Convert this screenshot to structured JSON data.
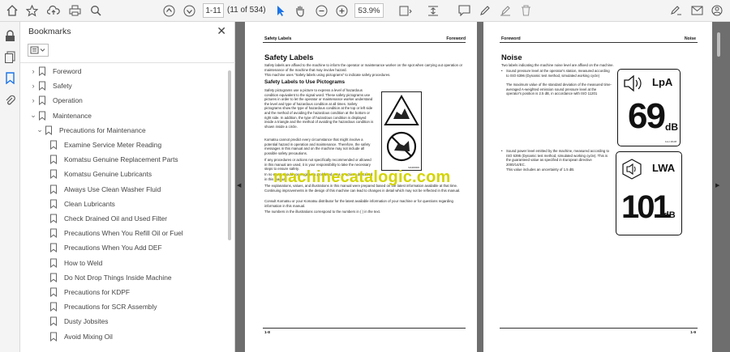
{
  "toolbar": {
    "page_current": "1-11",
    "page_count": "(11 of 534)",
    "zoom": "53.9%"
  },
  "bookmarks": {
    "title": "Bookmarks",
    "close_glyph": "✕",
    "items": [
      {
        "label": "Foreword",
        "level": 0,
        "caret": "›"
      },
      {
        "label": "Safety",
        "level": 0,
        "caret": "›"
      },
      {
        "label": "Operation",
        "level": 0,
        "caret": "›"
      },
      {
        "label": "Maintenance",
        "level": 0,
        "caret": "⌄"
      },
      {
        "label": "Precautions for Maintenance",
        "level": 1,
        "caret": "⌄"
      },
      {
        "label": "Examine Service Meter Reading",
        "level": 2,
        "caret": ""
      },
      {
        "label": "Komatsu Genuine Replacement Parts",
        "level": 2,
        "caret": ""
      },
      {
        "label": "Komatsu Genuine Lubricants",
        "level": 2,
        "caret": ""
      },
      {
        "label": "Always Use Clean Washer Fluid",
        "level": 2,
        "caret": ""
      },
      {
        "label": "Clean Lubricants",
        "level": 2,
        "caret": ""
      },
      {
        "label": "Check Drained Oil and Used Filter",
        "level": 2,
        "caret": ""
      },
      {
        "label": "Precautions When You Refill Oil or Fuel",
        "level": 2,
        "caret": ""
      },
      {
        "label": "Precautions When You Add DEF",
        "level": 2,
        "caret": ""
      },
      {
        "label": "How to Weld",
        "level": 2,
        "caret": ""
      },
      {
        "label": "Do Not Drop Things Inside Machine",
        "level": 2,
        "caret": ""
      },
      {
        "label": "Precautions for KDPF",
        "level": 2,
        "caret": ""
      },
      {
        "label": "Precautions for SCR Assembly",
        "level": 2,
        "caret": ""
      },
      {
        "label": "Dusty Jobsites",
        "level": 2,
        "caret": ""
      },
      {
        "label": "Avoid Mixing Oil",
        "level": 2,
        "caret": ""
      }
    ]
  },
  "left_page": {
    "header_left": "Safety Labels",
    "header_right": "Foreword",
    "title": "Safety Labels",
    "intro1": "Safety labels are affixed to the machine to inform the operator or maintenance worker on the spot when carrying out operation or maintenance of the machine that may involve hazard.",
    "intro2": "This machine uses “Safety labels using pictograms” to indicate safety procedures.",
    "subtitle": "Safety Labels to Use Pictograms",
    "para1": "Safety pictograms use a picture to express a level of hazardous condition equivalent to the signal word. These safety pictograms use pictures in order to let the operator or maintenance worker understand the level and type of hazardous condition at all times. Safety pictograms show the type of hazardous condition at the top or left side and the method of avoiding the hazardous condition at the bottom or right side. In addition, the type of hazardous condition is displayed inside a triangle and the method of avoiding the hazardous condition is shown inside a circle.",
    "para2": "Komatsu cannot predict every circumstance that might involve a potential hazard in operation and maintenance. Therefore, the safety messages in this manual and on the machine may not include all possible safety precautions.",
    "para3": "If any procedures or actions not specifically recommended or allowed in this manual are used, it is your responsibility to take the necessary steps to ensure safety.",
    "para4": "In no event should you engage in prohibited uses or actions described in this manual.",
    "para5": "The explanations, values, and illustrations in this manual were prepared based on the latest information available at that time. Continuing improvements in the design of this machine can lead to changes in detail which may not be reflected in this manual.",
    "para6": "Consult Komatsu or your Komatsu distributor for the latest available information of your machine or for questions regarding information in this manual.",
    "para7": "The numbers in the illustrations correspond to the numbers in ( ) in the text.",
    "figure_code": "9JH00000",
    "footer": "1-8"
  },
  "right_page": {
    "header_left": "Foreword",
    "header_right": "Noise",
    "title": "Noise",
    "intro": "Two labels indicating the machine noise level are affixed on the machine.",
    "bullet1": "Sound pressure level at the operator's station, measured according to ISO 6396 (Dynamic test method, simulated working cycle)",
    "bullet1b": "The maximum value of the standard deviation of the measured time-averaged A-weighted emission sound pressure level at the operator's position is 2.5 dB, in accordance with ISO 11201",
    "bullet2": "Sound power level emitted by the machine, measured according to ISO 6395 (Dynamic test method, simulated working cycle). This is the guaranteed value as specified in European directive 2000/14/EC.",
    "bullet2b": "This value includes an uncertainty of 1.5 dB.",
    "label1_symbol": "LpA",
    "label1_value": "69",
    "label1_unit": "dB",
    "label1_code": "1LH 18-08",
    "label2_symbol": "LWA",
    "label2_value": "101",
    "label2_unit": "dB",
    "footer": "1-9"
  },
  "watermark": "machinecatalogic.com",
  "colors": {
    "watermark": "#d4d400",
    "viewer_bg": "#6e6e6e",
    "accent_blue": "#1a73e8"
  }
}
